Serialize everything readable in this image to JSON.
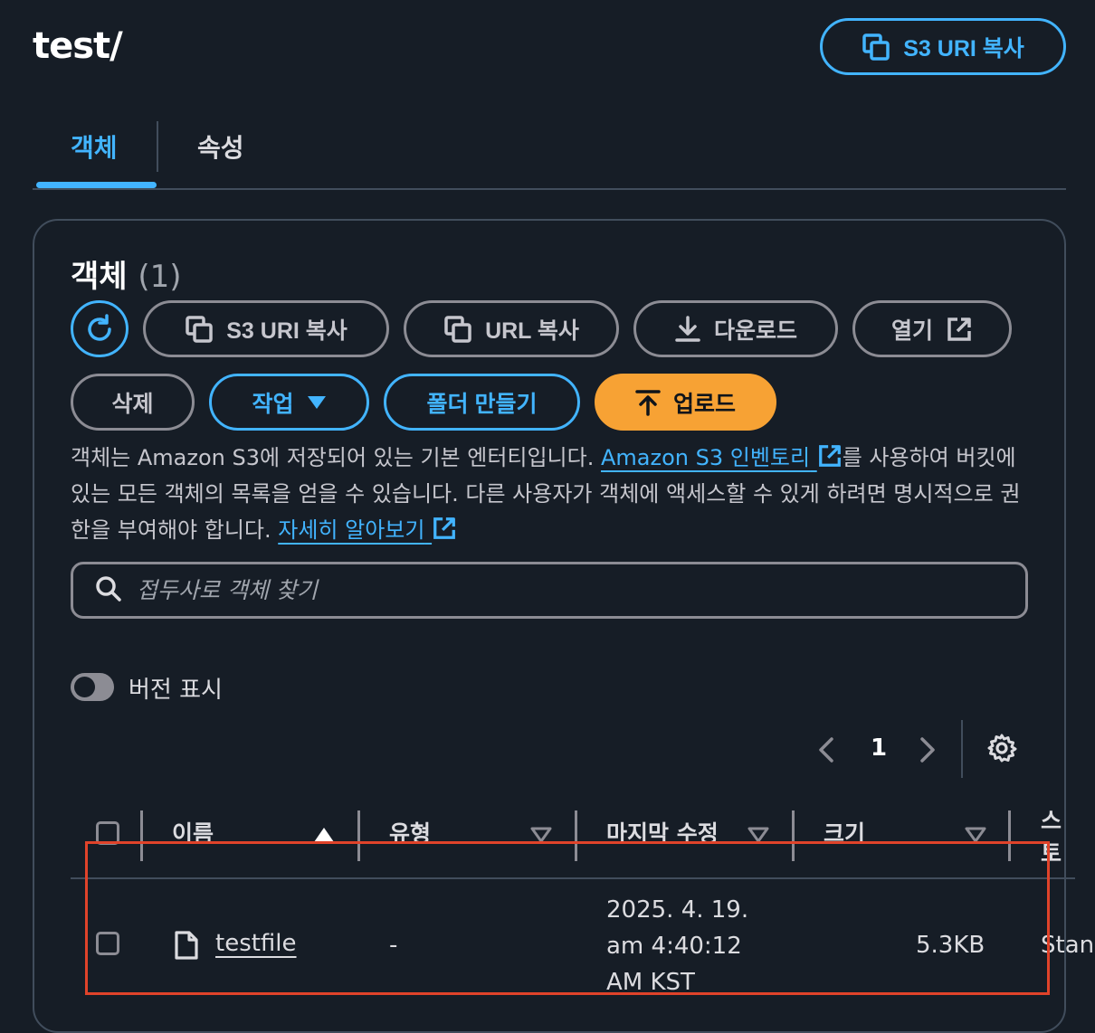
{
  "page": {
    "title": "test/"
  },
  "header": {
    "copy_s3_uri_label": "S3 URI 복사"
  },
  "tabs": [
    {
      "label": "객체",
      "active": true
    },
    {
      "label": "속성",
      "active": false
    }
  ],
  "objects_panel": {
    "heading": "객체",
    "count": "(1)",
    "toolbar": {
      "copy_s3_uri": "S3 URI 복사",
      "copy_url": "URL 복사",
      "download": "다운로드",
      "open": "열기",
      "delete": "삭제",
      "actions": "작업",
      "create_folder": "폴더 만들기",
      "upload": "업로드"
    },
    "description": {
      "part1": "객체는 Amazon S3에 저장되어 있는 기본 엔터티입니다. ",
      "inventory_link": "Amazon S3 인벤토리",
      "part2": "를 사용하여 버킷에 있는 모든 객체의 목록을 얻을 수 있습니다. 다른 사용자가 객체에 액세스할 수 있게 하려면 명시적으로 권한을 부여해야 합니다. ",
      "learn_more_link": "자세히 알아보기"
    },
    "search": {
      "placeholder": "접두사로 객체 찾기",
      "value": ""
    },
    "show_versions": {
      "label": "버전 표시",
      "enabled": false
    },
    "pagination": {
      "current_page": "1"
    },
    "table": {
      "columns": [
        "이름",
        "유형",
        "마지막 수정",
        "크기",
        "스토리지 클래스"
      ],
      "sort": {
        "column": "이름",
        "direction": "ascending"
      },
      "rows": [
        {
          "name": "testfile",
          "type": "-",
          "last_modified_line1": "2025. 4. 19.",
          "last_modified_line2": "am 4:40:12",
          "last_modified_line3": "AM KST",
          "size": "5.3KB",
          "storage_class": "Standard"
        }
      ]
    }
  },
  "colors": {
    "background": "#161d26",
    "accent_blue": "#42b4ff",
    "primary_orange": "#f7a234",
    "border_gray": "#8c8c94",
    "highlight_red": "#e0432a"
  }
}
